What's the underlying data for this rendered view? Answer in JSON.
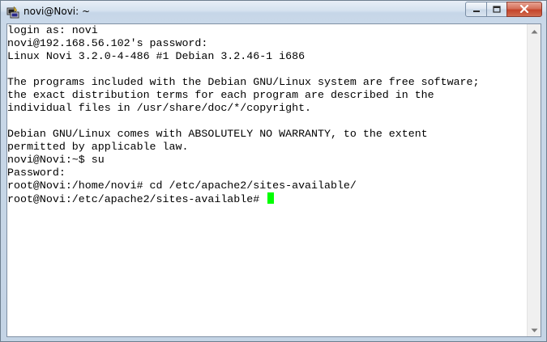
{
  "window": {
    "title": "novi@Novi: ~",
    "app_icon": "putty-icon",
    "controls": {
      "minimize_icon": "minimize-icon",
      "maximize_icon": "maximize-icon",
      "close_icon": "close-icon"
    }
  },
  "terminal": {
    "lines": [
      "login as: novi",
      "novi@192.168.56.102's password:",
      "Linux Novi 3.2.0-4-486 #1 Debian 3.2.46-1 i686",
      "",
      "The programs included with the Debian GNU/Linux system are free software;",
      "the exact distribution terms for each program are described in the",
      "individual files in /usr/share/doc/*/copyright.",
      "",
      "Debian GNU/Linux comes with ABSOLUTELY NO WARRANTY, to the extent",
      "permitted by applicable law.",
      "novi@Novi:~$ su",
      "Password:",
      "root@Novi:/home/novi# cd /etc/apache2/sites-available/",
      "root@Novi:/etc/apache2/sites-available# "
    ],
    "cursor_color": "#00ff00",
    "text_color": "#000000",
    "background": "#ffffff"
  },
  "scrollbar": {
    "up_icon": "scroll-up-arrow-icon",
    "down_icon": "scroll-down-arrow-icon"
  }
}
